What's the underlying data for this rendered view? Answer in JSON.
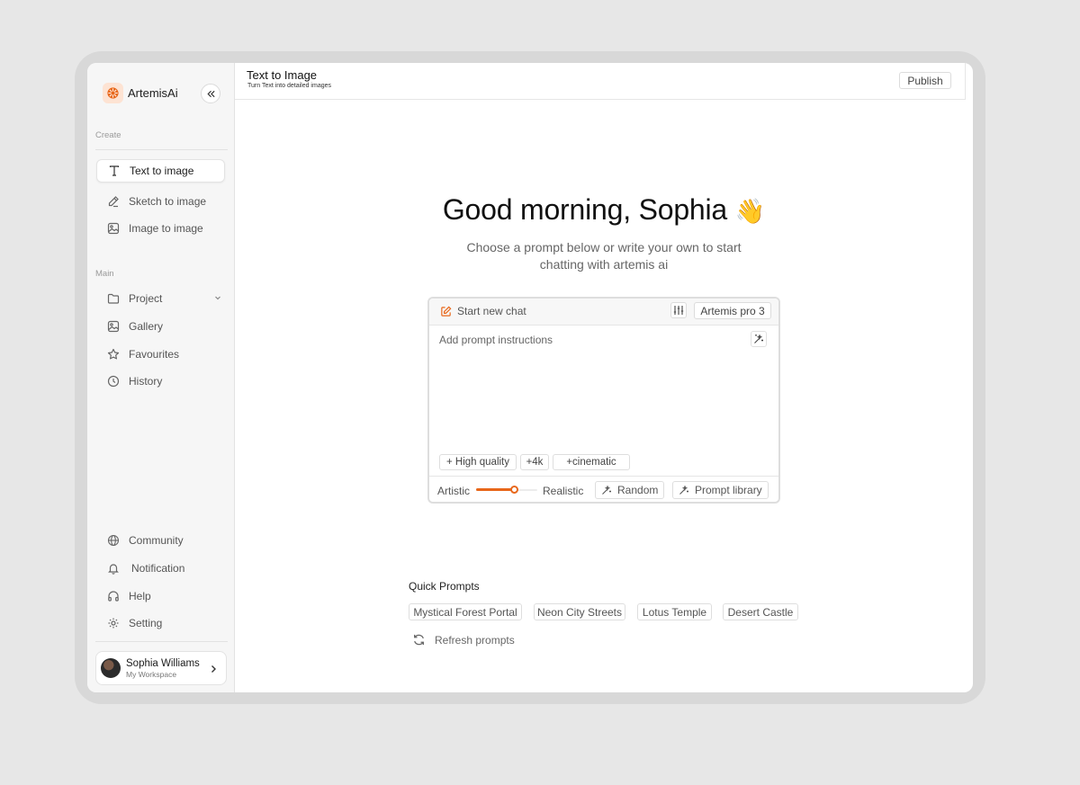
{
  "brand": {
    "name": "ArtemisAi",
    "accent": "#e8671a"
  },
  "sidebar": {
    "create_label": "Create",
    "create_items": [
      {
        "label": "Text to image",
        "icon": "text-icon",
        "active": true
      },
      {
        "label": "Sketch to image",
        "icon": "pencil-icon"
      },
      {
        "label": "Image to image",
        "icon": "image-icon"
      }
    ],
    "main_label": "Main",
    "main_items": [
      {
        "label": "Project",
        "icon": "folder-icon",
        "has_chevron": true
      },
      {
        "label": "Gallery",
        "icon": "gallery-icon"
      },
      {
        "label": "Favourites",
        "icon": "star-icon"
      },
      {
        "label": "History",
        "icon": "clock-icon"
      }
    ],
    "bottom_items": [
      {
        "label": "Community",
        "icon": "globe-icon"
      },
      {
        "label": "Notification",
        "icon": "bell-icon"
      },
      {
        "label": "Help",
        "icon": "headphones-icon"
      },
      {
        "label": "Setting",
        "icon": "gear-icon"
      }
    ],
    "user": {
      "name": "Sophia Williams",
      "workspace": "My Workspace"
    }
  },
  "header": {
    "title": "Text to Image",
    "subtitle": "Turn Text into detailed images",
    "publish_label": "Publish"
  },
  "hero": {
    "greeting": "Good morning, Sophia",
    "emoji": "👋",
    "line1": "Choose a prompt below or write your own to start",
    "line2": "chatting with artemis ai"
  },
  "composer": {
    "new_chat_label": "Start new chat",
    "model_label": "Artemis pro 3",
    "placeholder": "Add prompt instructions",
    "tags": [
      "+ High quality",
      "+4k",
      "+cinematic"
    ],
    "style_left": "Artistic",
    "style_right": "Realistic",
    "style_value": 0.62,
    "random_label": "Random",
    "library_label": "Prompt library"
  },
  "quick_prompts": {
    "title": "Quick Prompts",
    "items": [
      "Mystical Forest Portal",
      "Neon City Streets",
      "Lotus Temple",
      "Desert Castle"
    ],
    "refresh_label": "Refresh prompts"
  }
}
